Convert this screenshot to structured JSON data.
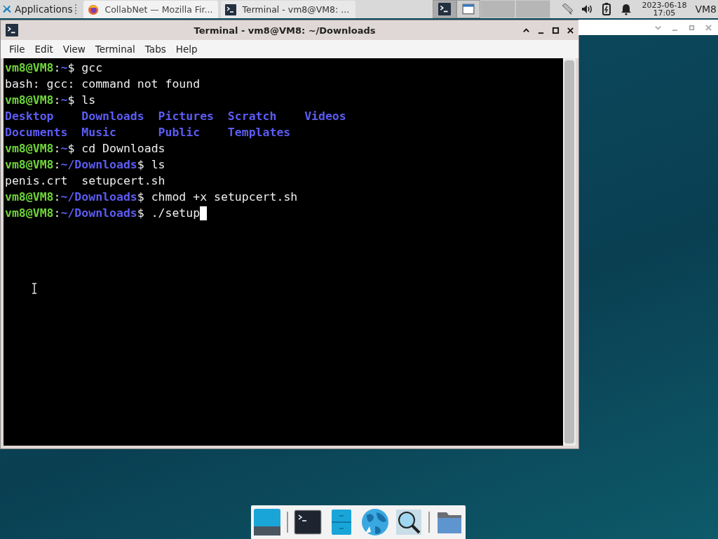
{
  "panel": {
    "apps_label": "Applications",
    "tasks": [
      {
        "label": "CollabNet — Mozilla Fir...",
        "kind": "browser",
        "selected": false
      },
      {
        "label": "Terminal - vm8@VM8: ...",
        "kind": "terminal",
        "selected": true
      }
    ],
    "clock": {
      "date": "2023-06-18",
      "time": "17:05"
    },
    "user": "VM8"
  },
  "window": {
    "title": "Terminal - vm8@VM8: ~/Downloads",
    "menu": [
      "File",
      "Edit",
      "View",
      "Terminal",
      "Tabs",
      "Help"
    ],
    "lines": [
      {
        "kind": "prompt",
        "user": "vm8@VM8",
        "sep": ":",
        "path": "~",
        "symbol": "$",
        "command": "gcc"
      },
      {
        "kind": "output",
        "text": "bash: gcc: command not found"
      },
      {
        "kind": "prompt",
        "user": "vm8@VM8",
        "sep": ":",
        "path": "~",
        "symbol": "$",
        "command": "ls"
      },
      {
        "kind": "listing",
        "entries": [
          "Desktop",
          "Downloads",
          "Pictures",
          "Scratch",
          "Videos"
        ]
      },
      {
        "kind": "listing",
        "entries": [
          "Documents",
          "Music",
          "Public",
          "Templates"
        ]
      },
      {
        "kind": "prompt",
        "user": "vm8@VM8",
        "sep": ":",
        "path": "~",
        "symbol": "$",
        "command": "cd Downloads"
      },
      {
        "kind": "prompt",
        "user": "vm8@VM8",
        "sep": ":",
        "path": "~/Downloads",
        "symbol": "$",
        "command": "ls"
      },
      {
        "kind": "output",
        "text": "penis.crt  setupcert.sh"
      },
      {
        "kind": "prompt",
        "user": "vm8@VM8",
        "sep": ":",
        "path": "~/Downloads",
        "symbol": "$",
        "command": "chmod +x setupcert.sh"
      },
      {
        "kind": "prompt",
        "user": "vm8@VM8",
        "sep": ":",
        "path": "~/Downloads",
        "symbol": "$",
        "command": "./setup",
        "cursor": true
      }
    ]
  },
  "dock": [
    {
      "kind": "desktop"
    },
    {
      "kind": "terminal"
    },
    {
      "kind": "files"
    },
    {
      "kind": "browser"
    },
    {
      "kind": "search"
    },
    {
      "kind": "folder"
    }
  ]
}
